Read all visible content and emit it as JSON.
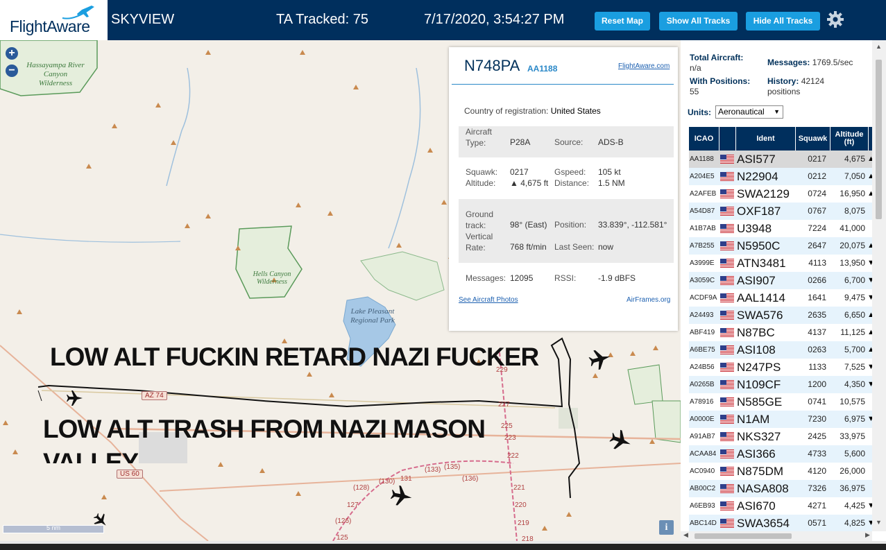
{
  "header": {
    "logo_text": "FlightAware",
    "app_title": "SKYVIEW",
    "ta_tracked": "TA Tracked: 75",
    "clock": "7/17/2020, 3:54:27 PM",
    "buttons": {
      "reset_map": "Reset Map",
      "show_all_tracks": "Show All Tracks",
      "hide_all_tracks": "Hide All Tracks"
    }
  },
  "map": {
    "zoom_in": "+",
    "zoom_out": "−",
    "labels": {
      "hassayampa": "Hassayampa River Canyon Wilderness",
      "hells_canyon": "Hells Canyon Wilderness",
      "lake_pleasant": "Lake Pleasant Regional Park"
    },
    "road_shields": [
      "AZ 74",
      "US 60"
    ],
    "road_numbers": [
      "229",
      "227",
      "225",
      "223",
      "222",
      "221",
      "220",
      "219",
      "218",
      "(135)",
      "(133)",
      "(136)",
      "131",
      "(130)",
      "(128)",
      "127",
      "(126)",
      "125"
    ],
    "overlay_text": [
      "LOW ALT FUCKIN RETARD NAZI FUCKER",
      "LOW ALT TRASH FROM NAZI MASON",
      "VALLEY"
    ],
    "scale_label": "5 nm",
    "info_button": "i"
  },
  "aircraft_card": {
    "registration": "N748PA",
    "flight": "AA1188",
    "flightaware_link": "FlightAware.com",
    "country_label": "Country of registration:",
    "country": "United States",
    "aircraft_type_label": "Aircraft Type:",
    "aircraft_type": "P28A",
    "source_label": "Source:",
    "source": "ADS-B",
    "squawk_label": "Squawk:",
    "squawk": "0217",
    "altitude_label": "Altitude:",
    "altitude": "▲ 4,675 ft",
    "gspeed_label": "Gspeed:",
    "gspeed": "105 kt",
    "distance_label": "Distance:",
    "distance": "1.5 NM",
    "ground_track_label": "Ground track:",
    "ground_track": "98° (East)",
    "position_label": "Position:",
    "position": "33.839°, -112.581°",
    "vertical_rate_label": "Vertical Rate:",
    "vertical_rate": "768 ft/min",
    "last_seen_label": "Last Seen:",
    "last_seen": "now",
    "messages_label": "Messages:",
    "messages": "12095",
    "rssi_label": "RSSI:",
    "rssi": "-1.9 dBFS",
    "photos_link": "See Aircraft Photos",
    "airframes_link": "AirFrames.org"
  },
  "panel": {
    "total_aircraft_label": "Total Aircraft:",
    "total_aircraft": "n/a",
    "messages_label": "Messages:",
    "messages": "1769.5/sec",
    "with_positions_label": "With Positions:",
    "with_positions": "55",
    "history_label": "History:",
    "history": "42124 positions",
    "units_label": "Units:",
    "units_value": "Aeronautical",
    "columns": [
      "ICAO",
      "",
      "Ident",
      "Squawk",
      "Altitude (ft)"
    ],
    "rows": [
      {
        "icao": "AA1188",
        "ident": "ASI577",
        "squawk": "0217",
        "alt": "4,675",
        "trend": "▲"
      },
      {
        "icao": "A204E5",
        "ident": "N22904",
        "squawk": "0212",
        "alt": "7,050",
        "trend": "▲"
      },
      {
        "icao": "A2AFEB",
        "ident": "SWA2129",
        "squawk": "0724",
        "alt": "16,950",
        "trend": "▲"
      },
      {
        "icao": "A54D87",
        "ident": "OXF187",
        "squawk": "0767",
        "alt": "8,075",
        "trend": ""
      },
      {
        "icao": "A1B7AB",
        "ident": "U3948",
        "squawk": "7224",
        "alt": "41,000",
        "trend": ""
      },
      {
        "icao": "A7B255",
        "ident": "N5950C",
        "squawk": "2647",
        "alt": "20,075",
        "trend": "▲"
      },
      {
        "icao": "A3999E",
        "ident": "ATN3481",
        "squawk": "4113",
        "alt": "13,950",
        "trend": "▼"
      },
      {
        "icao": "A3059C",
        "ident": "ASI907",
        "squawk": "0266",
        "alt": "6,700",
        "trend": "▼"
      },
      {
        "icao": "ACDF9A",
        "ident": "AAL1414",
        "squawk": "1641",
        "alt": "9,475",
        "trend": "▼"
      },
      {
        "icao": "A24493",
        "ident": "SWA576",
        "squawk": "2635",
        "alt": "6,650",
        "trend": "▲"
      },
      {
        "icao": "ABF419",
        "ident": "N87BC",
        "squawk": "4137",
        "alt": "11,125",
        "trend": "▲"
      },
      {
        "icao": "A6BE75",
        "ident": "ASI108",
        "squawk": "0263",
        "alt": "5,700",
        "trend": "▲"
      },
      {
        "icao": "A24B56",
        "ident": "N247PS",
        "squawk": "1133",
        "alt": "7,525",
        "trend": "▼"
      },
      {
        "icao": "A0265B",
        "ident": "N109CF",
        "squawk": "1200",
        "alt": "4,350",
        "trend": "▼"
      },
      {
        "icao": "A78916",
        "ident": "N585GE",
        "squawk": "0741",
        "alt": "10,575",
        "trend": ""
      },
      {
        "icao": "A0000E",
        "ident": "N1AM",
        "squawk": "7230",
        "alt": "6,975",
        "trend": "▼"
      },
      {
        "icao": "A91AB7",
        "ident": "NKS327",
        "squawk": "2425",
        "alt": "33,975",
        "trend": ""
      },
      {
        "icao": "ACAA84",
        "ident": "ASI366",
        "squawk": "4733",
        "alt": "5,600",
        "trend": ""
      },
      {
        "icao": "AC0940",
        "ident": "N875DM",
        "squawk": "4120",
        "alt": "26,000",
        "trend": ""
      },
      {
        "icao": "AB00C2",
        "ident": "NASA808",
        "squawk": "7326",
        "alt": "36,975",
        "trend": ""
      },
      {
        "icao": "A6EB93",
        "ident": "ASI670",
        "squawk": "4271",
        "alt": "4,425",
        "trend": "▼"
      },
      {
        "icao": "ABC14D",
        "ident": "SWA3654",
        "squawk": "0571",
        "alt": "4,825",
        "trend": "▼"
      }
    ]
  },
  "icons": {
    "gear": "gear-icon",
    "plane": "airplane-icon",
    "flag": "us-flag-icon"
  },
  "colors": {
    "header_bg": "#002f5d",
    "button": "#1a9ee0",
    "row_alt": "#e6f3fc",
    "map_bg": "#f3efe8"
  }
}
